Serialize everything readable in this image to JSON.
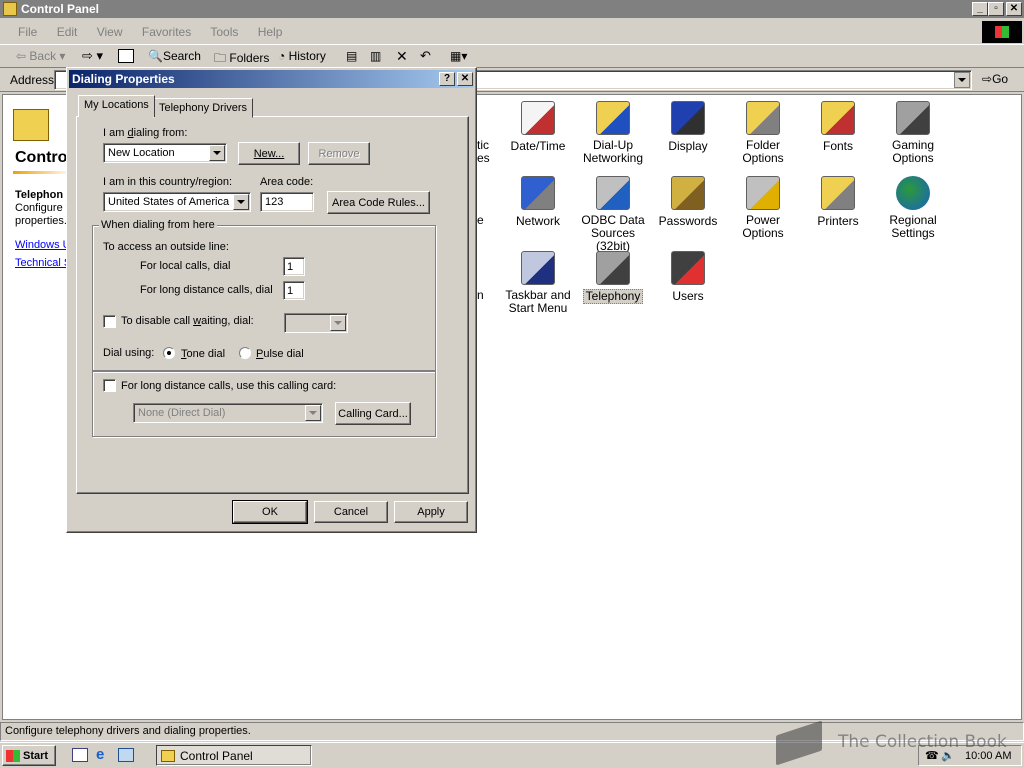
{
  "window": {
    "title": "Control Panel"
  },
  "menu": [
    "File",
    "Edit",
    "View",
    "Favorites",
    "Tools",
    "Help"
  ],
  "toolbar": {
    "back": "Back",
    "search": "Search",
    "folders": "Folders",
    "history": "History"
  },
  "address": {
    "label": "Address",
    "go": "Go"
  },
  "left_pane": {
    "heading": "Contro",
    "item_title": "Telephon",
    "item_desc_lines": [
      "Configure t",
      "properties."
    ],
    "links": [
      "Windows U",
      "Technical S"
    ]
  },
  "icons": [
    {
      "label": "Date/Time",
      "icon": "clock-calendar-icon"
    },
    {
      "label": "Dial-Up Networking",
      "icon": "dialup-networking-icon"
    },
    {
      "label": "Display",
      "icon": "monitor-icon"
    },
    {
      "label": "Folder Options",
      "icon": "folder-options-icon"
    },
    {
      "label": "Fonts",
      "icon": "fonts-folder-icon"
    },
    {
      "label": "Gaming Options",
      "icon": "joystick-icon"
    },
    {
      "label": "Network",
      "icon": "network-icon"
    },
    {
      "label": "ODBC Data Sources (32bit)",
      "icon": "odbc-icon"
    },
    {
      "label": "Passwords",
      "icon": "keys-icon"
    },
    {
      "label": "Power Options",
      "icon": "power-icon"
    },
    {
      "label": "Printers",
      "icon": "printer-folder-icon"
    },
    {
      "label": "Regional Settings",
      "icon": "globe-icon"
    },
    {
      "label": "Taskbar and Start Menu",
      "icon": "taskbar-icon"
    },
    {
      "label": "Telephony",
      "icon": "telephony-icon",
      "selected": true
    },
    {
      "label": "Users",
      "icon": "users-icon"
    }
  ],
  "partial_icon_labels": [
    "tic",
    "es",
    "e",
    "n"
  ],
  "dialog": {
    "title": "Dialing Properties",
    "tabs": [
      "My Locations",
      "Telephony Drivers"
    ],
    "dialing_from_label": "I am dialing from:",
    "location_value": "New Location",
    "new_btn": "New...",
    "remove_btn": "Remove",
    "country_label": "I am in this country/region:",
    "country_value": "United States of America",
    "area_code_label": "Area code:",
    "area_code_value": "123",
    "area_code_rules_btn": "Area Code Rules...",
    "when_dialing_label": "When dialing from here",
    "outside_line_label": "To access an outside line:",
    "local_calls_label": "For local calls, dial",
    "local_calls_value": "1",
    "long_distance_label": "For long distance calls, dial",
    "long_distance_value": "1",
    "call_waiting_label": "To disable call waiting, dial:",
    "dial_using_label": "Dial using:",
    "tone_dial": "Tone dial",
    "pulse_dial": "Pulse dial",
    "calling_card_label": "For long distance calls, use this calling card:",
    "calling_card_value": "None (Direct Dial)",
    "calling_card_btn": "Calling Card...",
    "ok": "OK",
    "cancel": "Cancel",
    "apply": "Apply"
  },
  "status_bar": "Configure telephony drivers and dialing properties.",
  "taskbar": {
    "start": "Start",
    "task": "Control Panel",
    "clock": "10:00 AM"
  },
  "watermark": "The Collection Book",
  "colors": {
    "titlebar_active": "#0a246a",
    "titlebar_inactive": "#808080",
    "desktop": "#d4d0c8"
  }
}
